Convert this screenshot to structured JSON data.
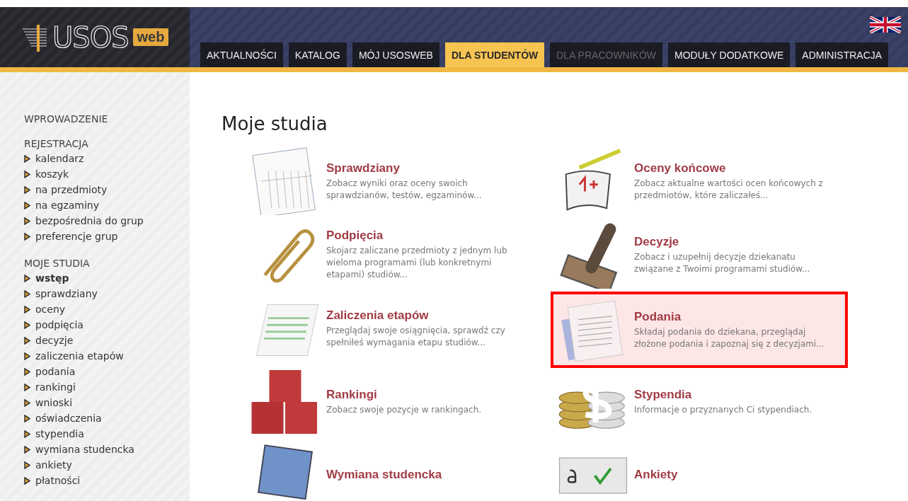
{
  "logo": {
    "name": "USOS",
    "badge": "web"
  },
  "tabs": [
    {
      "label": "AKTUALNOŚCI",
      "selected": false,
      "disabled": false
    },
    {
      "label": "KATALOG",
      "selected": false,
      "disabled": false
    },
    {
      "label": "MÓJ USOSWEB",
      "selected": false,
      "disabled": false
    },
    {
      "label": "DLA STUDENTÓW",
      "selected": true,
      "disabled": false
    },
    {
      "label": "DLA PRACOWNIKÓW",
      "selected": false,
      "disabled": true
    },
    {
      "label": "MODUŁY DODATKOWE",
      "selected": false,
      "disabled": false
    },
    {
      "label": "ADMINISTRACJA",
      "selected": false,
      "disabled": false
    }
  ],
  "sidebar": {
    "sections": [
      {
        "title": "WPROWADZENIE"
      },
      {
        "title": "REJESTRACJA",
        "items": [
          {
            "label": "kalendarz",
            "selected": false
          },
          {
            "label": "koszyk",
            "selected": false
          },
          {
            "label": "na przedmioty",
            "selected": false
          },
          {
            "label": "na egzaminy",
            "selected": false
          },
          {
            "label": "bezpośrednia do grup",
            "selected": false
          },
          {
            "label": "preferencje grup",
            "selected": false
          }
        ]
      },
      {
        "title": "MOJE STUDIA",
        "items": [
          {
            "label": "wstęp",
            "selected": true
          },
          {
            "label": "sprawdziany",
            "selected": false
          },
          {
            "label": "oceny",
            "selected": false
          },
          {
            "label": "podpięcia",
            "selected": false
          },
          {
            "label": "decyzje",
            "selected": false
          },
          {
            "label": "zaliczenia etapów",
            "selected": false
          },
          {
            "label": "podania",
            "selected": false
          },
          {
            "label": "rankingi",
            "selected": false
          },
          {
            "label": "wnioski",
            "selected": false
          },
          {
            "label": "oświadczenia",
            "selected": false
          },
          {
            "label": "stypendia",
            "selected": false
          },
          {
            "label": "wymiana studencka",
            "selected": false
          },
          {
            "label": "ankiety",
            "selected": false
          },
          {
            "label": "płatności",
            "selected": false
          }
        ]
      }
    ]
  },
  "page_title": "Moje studia",
  "tiles": [
    {
      "kind": "sheet",
      "title": "Sprawdziany",
      "description": "Zobacz wyniki oraz oceny swoich sprawdzianów, testów, egzaminów...",
      "highlighted": false
    },
    {
      "kind": "grade",
      "title": "Oceny końcowe",
      "description": "Zobacz aktualne wartości ocen końcowych z przedmiotów, które zaliczałeś...",
      "highlighted": false
    },
    {
      "kind": "paperclip",
      "title": "Podpięcia",
      "description": "Skojarz zaliczane przedmioty z jednym lub wieloma programami (lub konkretnymi etapami) studiów...",
      "highlighted": false
    },
    {
      "kind": "stamp",
      "title": "Decyzje",
      "description": "Zobacz i uzupełnij decyzje dziekanatu związane z Twoimi programami studiów...",
      "highlighted": false
    },
    {
      "kind": "report",
      "title": "Zaliczenia etapów",
      "description": "Przeglądaj swoje osiągnięcia, sprawdź czy spełniłeś wymagania etapu studiów...",
      "highlighted": false
    },
    {
      "kind": "letter",
      "title": "Podania",
      "description": "Składaj podania do dziekana, przeglądaj złożone podania i zapoznaj się z decyzjami...",
      "highlighted": true
    },
    {
      "kind": "cubes",
      "title": "Rankingi",
      "description": "Zobacz swoje pozycje w rankingach.",
      "highlighted": false
    },
    {
      "kind": "coins",
      "title": "Stypendia",
      "description": "Informacje o przyznanych Ci stypendiach.",
      "highlighted": false
    },
    {
      "kind": "photo",
      "title": "Wymiana studencka",
      "highlighted": false
    },
    {
      "kind": "survey",
      "title": "Ankiety",
      "highlighted": false
    }
  ]
}
